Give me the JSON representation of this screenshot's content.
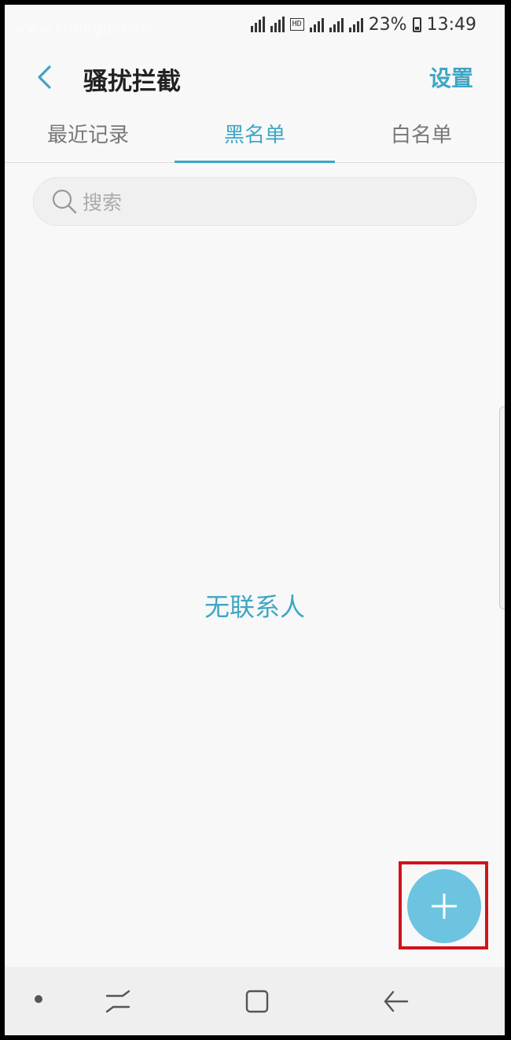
{
  "status_bar": {
    "watermark": "www.chongdi.com",
    "battery": "23%",
    "time": "13:49"
  },
  "header": {
    "title": "骚扰拦截",
    "settings_label": "设置"
  },
  "tabs": [
    {
      "label": "最近记录",
      "active": false
    },
    {
      "label": "黑名单",
      "active": true
    },
    {
      "label": "白名单",
      "active": false
    }
  ],
  "search": {
    "placeholder": "搜索"
  },
  "main": {
    "empty_text": "无联系人"
  },
  "fab": {
    "icon": "plus-icon"
  },
  "colors": {
    "accent": "#3ea6c4",
    "fab": "#6cc4e0",
    "highlight": "#d0141b"
  }
}
